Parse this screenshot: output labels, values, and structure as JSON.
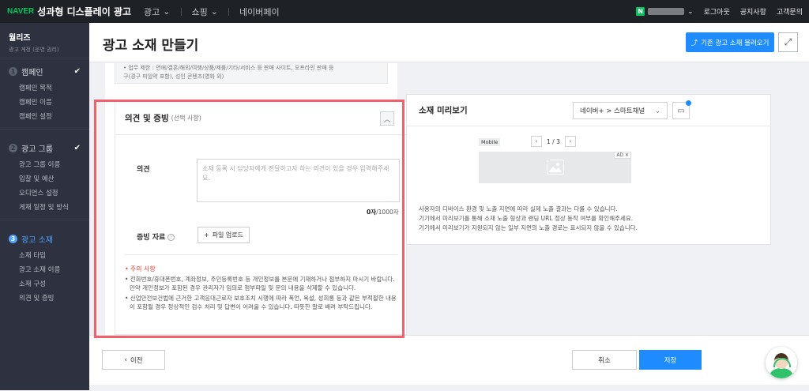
{
  "topbar": {
    "brand": "NAVER",
    "product": "성과형 디스플레이 광고",
    "menu": [
      {
        "label": "광고",
        "caret": "⌄"
      },
      {
        "label": "쇼핑",
        "caret": "⌄"
      },
      {
        "label": "네이버페이"
      }
    ],
    "user_badge": "N",
    "logout": "로그아웃",
    "notice": "공지사항",
    "support": "고객문의"
  },
  "sidebar": {
    "account_name": "월리즈",
    "account_role": "광고 계정 (운영 권리)",
    "steps": [
      {
        "num": "1",
        "label": "캠페인",
        "done": true,
        "items": [
          "캠페인 목적",
          "캠페인 이름",
          "캠페인 설정"
        ]
      },
      {
        "num": "2",
        "label": "광고 그룹",
        "done": true,
        "items": [
          "광고 그룹 이름",
          "입찰 및 예산",
          "오디언스 설정",
          "게재 일정 및 방식"
        ]
      },
      {
        "num": "3",
        "label": "광고 소재",
        "done": false,
        "items": [
          "소재 타입",
          "광고 소재 이름",
          "소재 구성",
          "의견 및 증빙"
        ]
      }
    ]
  },
  "header": {
    "title": "광고 소재 만들기",
    "load_button": "기존 광고 소재 불러오기"
  },
  "prev_section": {
    "line1": "• 업무 제한 : 연애/결혼/해외/여행/상품/제품/기타/서비스 등 판매 사이트, 오프라인 판매 등",
    "line2": "구(경구 피임약 포함), 성인 콘텐츠(영화 외)"
  },
  "opinion": {
    "title": "의견 및 증빙",
    "optional": "(선택 사항)",
    "opinion_label": "의견",
    "opinion_placeholder": "소재 등록 시 담당자에게 전달하고자 하는 의견이 있을 경우 입력해주세요.",
    "counter_current": "0자",
    "counter_max": "/1000자",
    "evidence_label": "증빙 자료",
    "upload_button": "파일 업로드",
    "caution_title": "주의 사항",
    "caution_items": [
      "• 전화번호/휴대폰번호, 계좌정보, 주민등록번호 등 개인정보를 본문에 기재하거나 첨부하지 마시기 바랍니다. 만약 개인정보가 포함된 경우 관리자가 임의로 첨부파일 및 문의 내용을 삭제할 수 있습니다.",
      "• 산업안전보건법에 근거한 고객응대근로자 보호조치 시행에 따라 폭언, 욕설, 성희롱 등과 같은 부적절한 내용이 포함될 경우 정상적인 검수 처리 및 답변이 어려울 수 있습니다. 따뜻한 말로 배려 부탁드립니다."
    ]
  },
  "preview": {
    "title": "소재 미리보기",
    "channel": "네이버+ > 스마트채널",
    "mobile_tag": "Mobile",
    "page": "1 / 3",
    "ad_tag": "AD ✕",
    "notes": [
      "사용자의 디바이스 환경 및 노출 지면에 따라 실제 노출 결과는 다를 수 있습니다.",
      "기기에서 미리보기를 통해 소재 노출 형상과 랜딩 URL 정상 동작 여부를 확인해주세요.",
      "기기에서 미리보기가 지원되지 않는 일부 지면의 노출 경로는 표시되지 않을 수 있습니다."
    ]
  },
  "footer": {
    "prev_button": "이전",
    "cancel_button": "취소",
    "save_button": "저장"
  },
  "colors": {
    "accent": "#1e8cff",
    "highlight_frame": "#f0616b",
    "caution": "#e8463a",
    "naver_green": "#03c75a"
  }
}
